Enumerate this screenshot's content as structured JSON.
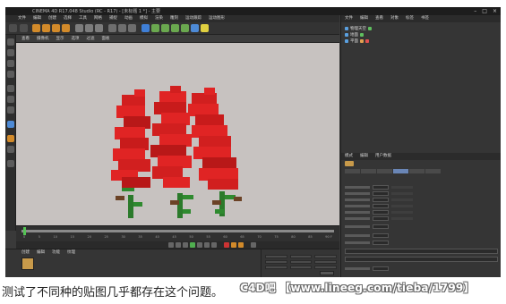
{
  "window": {
    "title": "CINEMA 4D R17.048 Studio (RC - R17) - [未标题 1 *] - 主要"
  },
  "main_menu": [
    "文件",
    "编辑",
    "创建",
    "选择",
    "工具",
    "网格",
    "捕捉",
    "动画",
    "模拟",
    "渲染",
    "雕刻",
    "运动跟踪",
    "运动图形",
    "角色",
    "流水线",
    "插件",
    "脚本",
    "窗口",
    "帮助"
  ],
  "viewport_menu": [
    "查看",
    "摄像机",
    "显示",
    "选项",
    "过滤",
    "面板"
  ],
  "viewport": {
    "background": "#c7c2c0",
    "subject": "red flower stems with green stalks"
  },
  "timeline_ticks": [
    "0",
    "5",
    "10",
    "15",
    "20",
    "25",
    "30",
    "35",
    "40",
    "45",
    "50",
    "55",
    "60",
    "65",
    "70",
    "75",
    "80",
    "85",
    "90 F"
  ],
  "material_menu": [
    "创建",
    "编辑",
    "功能",
    "纹理"
  ],
  "object_manager": {
    "tabs": [
      "文件",
      "编辑",
      "查看",
      "对象",
      "标签",
      "书签"
    ],
    "objects": [
      "物理天空",
      "地面",
      "平面"
    ]
  },
  "attributes": {
    "tabs": [
      "模式",
      "编辑",
      "用户数据"
    ]
  },
  "caption": "测试了不同种的贴图几乎都存在这个问题。",
  "watermark": "C4D吧 【www.lineeg.com/tieba/1799】",
  "icons": [
    "play-icon",
    "record-icon",
    "move-icon",
    "rotate-icon",
    "scale-icon",
    "cube-icon",
    "camera-icon",
    "light-icon",
    "window-close-icon",
    "window-minimize-icon",
    "window-maximize-icon"
  ]
}
